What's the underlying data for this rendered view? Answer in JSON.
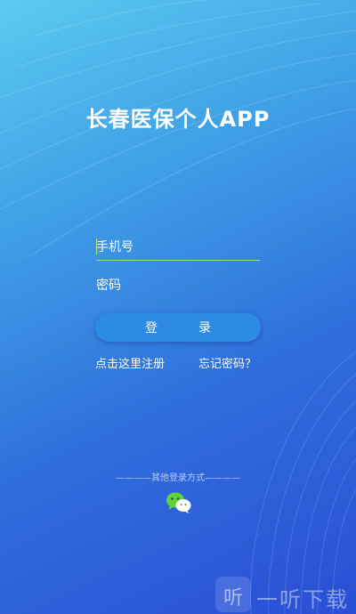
{
  "app": {
    "title": "长春医保个人APP"
  },
  "login_form": {
    "phone_placeholder": "手机号",
    "password_placeholder": "密码",
    "login_label": "登录"
  },
  "links": {
    "register": "点击这里注册",
    "forgot_password": "忘记密码？"
  },
  "other_login": {
    "label": "————其他登录方式————",
    "icon": "wechat-icon"
  },
  "watermark": {
    "badge_glyph": "听",
    "text": "一听下载"
  },
  "colors": {
    "gradient_top": "#5ccaf0",
    "gradient_bottom": "#2a4ed6",
    "button": "#2d8be6",
    "wechat_green": "#5fd339"
  }
}
